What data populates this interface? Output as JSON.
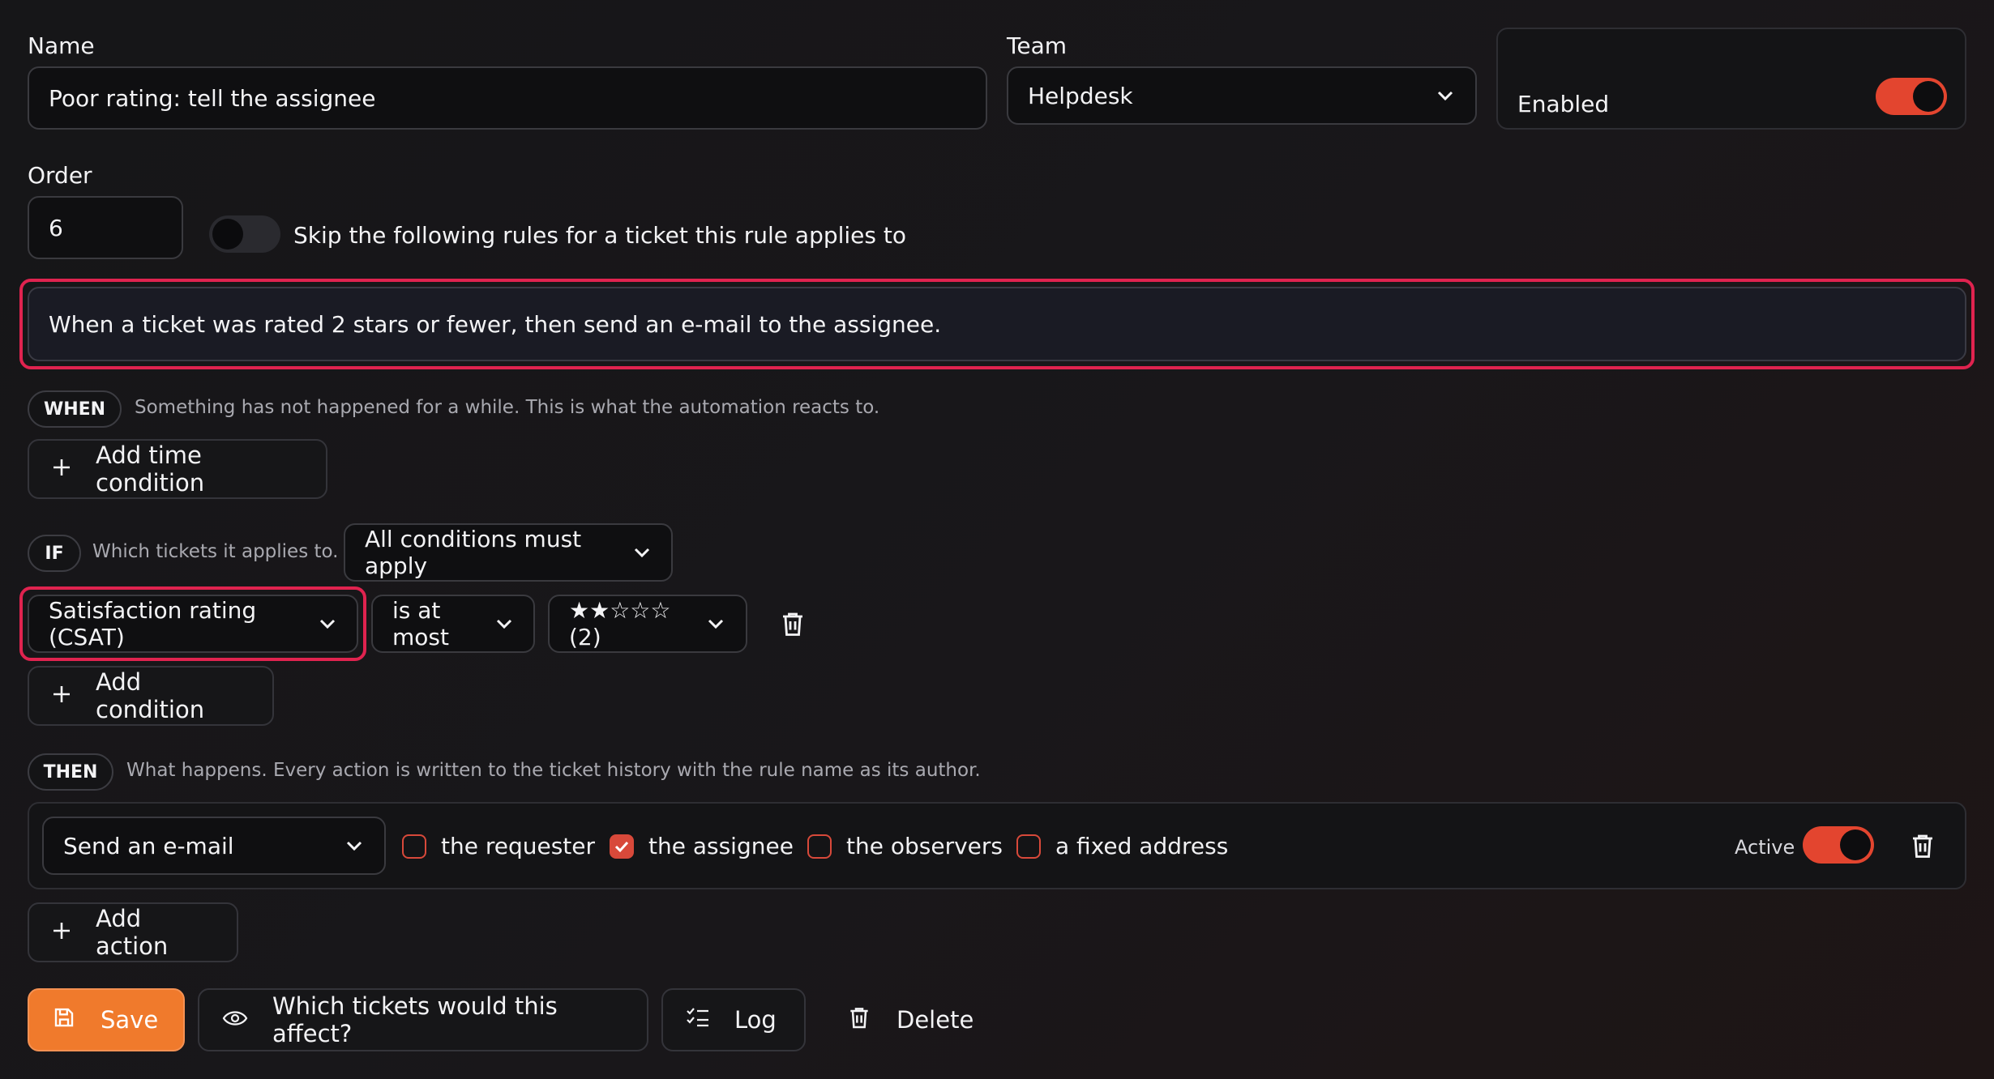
{
  "form": {
    "name_label": "Name",
    "name_value": "Poor rating: tell the assignee",
    "team_label": "Team",
    "team_value": "Helpdesk",
    "enabled_label": "Enabled",
    "order_label": "Order",
    "order_value": "6",
    "skip_label": "Skip the following rules for a ticket this rule applies to",
    "description": "When a ticket was rated 2 stars or fewer, then send an e-mail to the assignee."
  },
  "when": {
    "tag": "WHEN",
    "hint": "Something has not happened for a while. This is what the automation reacts to.",
    "add_label": "Add time condition"
  },
  "if": {
    "tag": "IF",
    "hint": "Which tickets it applies to.",
    "mode": "All conditions must apply",
    "condition": {
      "field": "Satisfaction rating (CSAT)",
      "operator": "is at most",
      "value": "★★☆☆☆ (2)"
    },
    "add_label": "Add condition"
  },
  "then": {
    "tag": "THEN",
    "hint": "What happens. Every action is written to the ticket history with the rule name as its author.",
    "action": {
      "type": "Send an e-mail",
      "recipients": [
        {
          "label": "the requester",
          "checked": false
        },
        {
          "label": "the assignee",
          "checked": true
        },
        {
          "label": "the observers",
          "checked": false
        },
        {
          "label": "a fixed address",
          "checked": false
        }
      ],
      "active_label": "Active"
    },
    "add_label": "Add action"
  },
  "footer": {
    "save": "Save",
    "preview": "Which tickets would this affect?",
    "log": "Log",
    "delete": "Delete"
  },
  "colors": {
    "accent": "#e3452f",
    "save": "#f07a2c",
    "highlight": "#e0234f"
  }
}
